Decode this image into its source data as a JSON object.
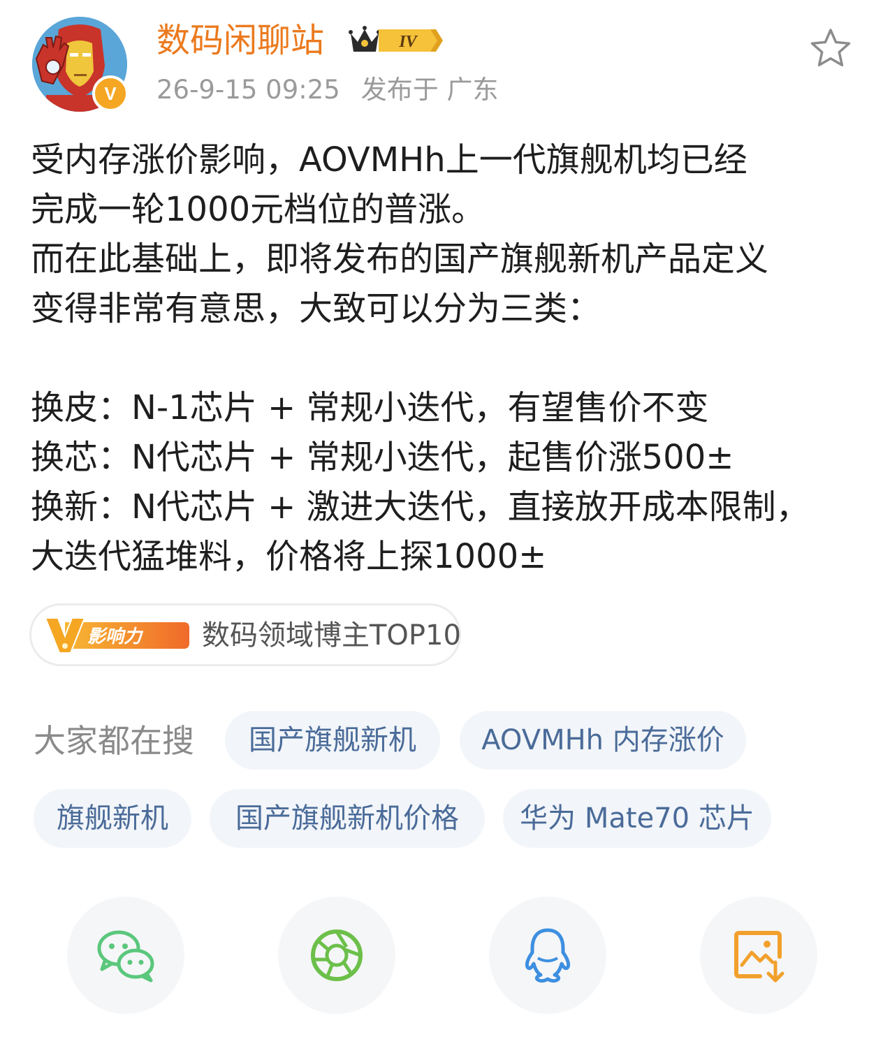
{
  "author": {
    "name": "数码闲聊站",
    "level": "IV",
    "verified_mark": "V",
    "timestamp": "26-9-15 09:25",
    "location": "发布于 广东",
    "avatar_icon": "iron-man-avatar",
    "favorite_icon": "star-outline-icon"
  },
  "post": {
    "lines": [
      "受内存涨价影响，AOVMHh上一代旗舰机均已经",
      "完成一轮1000元档位的普涨。",
      "而在此基础上，即将发布的国产旗舰新机产品定义",
      "变得非常有意思，大致可以分为三类：",
      "",
      "换皮：N-1芯片 + 常规小迭代，有望售价不变",
      "换芯：N代芯片 + 常规小迭代，起售价涨500±",
      "换新：N代芯片 + 激进大迭代，直接放开成本限制，",
      "大迭代猛堆料，价格将上探1000±"
    ]
  },
  "influence": {
    "badge_mark": "V",
    "badge_label": "影响力",
    "text": "数码领域博主TOP10"
  },
  "hot_search": {
    "label": "大家都在搜",
    "chips": [
      "国产旗舰新机",
      "AOVMHh 内存涨价",
      "旗舰新机",
      "国产旗舰新机价格",
      "华为 Mate70 芯片"
    ]
  },
  "share": {
    "icons": [
      "wechat-icon",
      "moments-icon",
      "qq-icon",
      "save-image-icon"
    ]
  },
  "colors": {
    "username": "#eb7a1e",
    "meta": "#9a9a9a",
    "chip_text": "#4a6b99",
    "chip_bg": "#f2f5f9",
    "wechat": "#5bc77c",
    "moments": "#6cc04a",
    "qq": "#3d8fe0",
    "save": "#f2a02c"
  }
}
